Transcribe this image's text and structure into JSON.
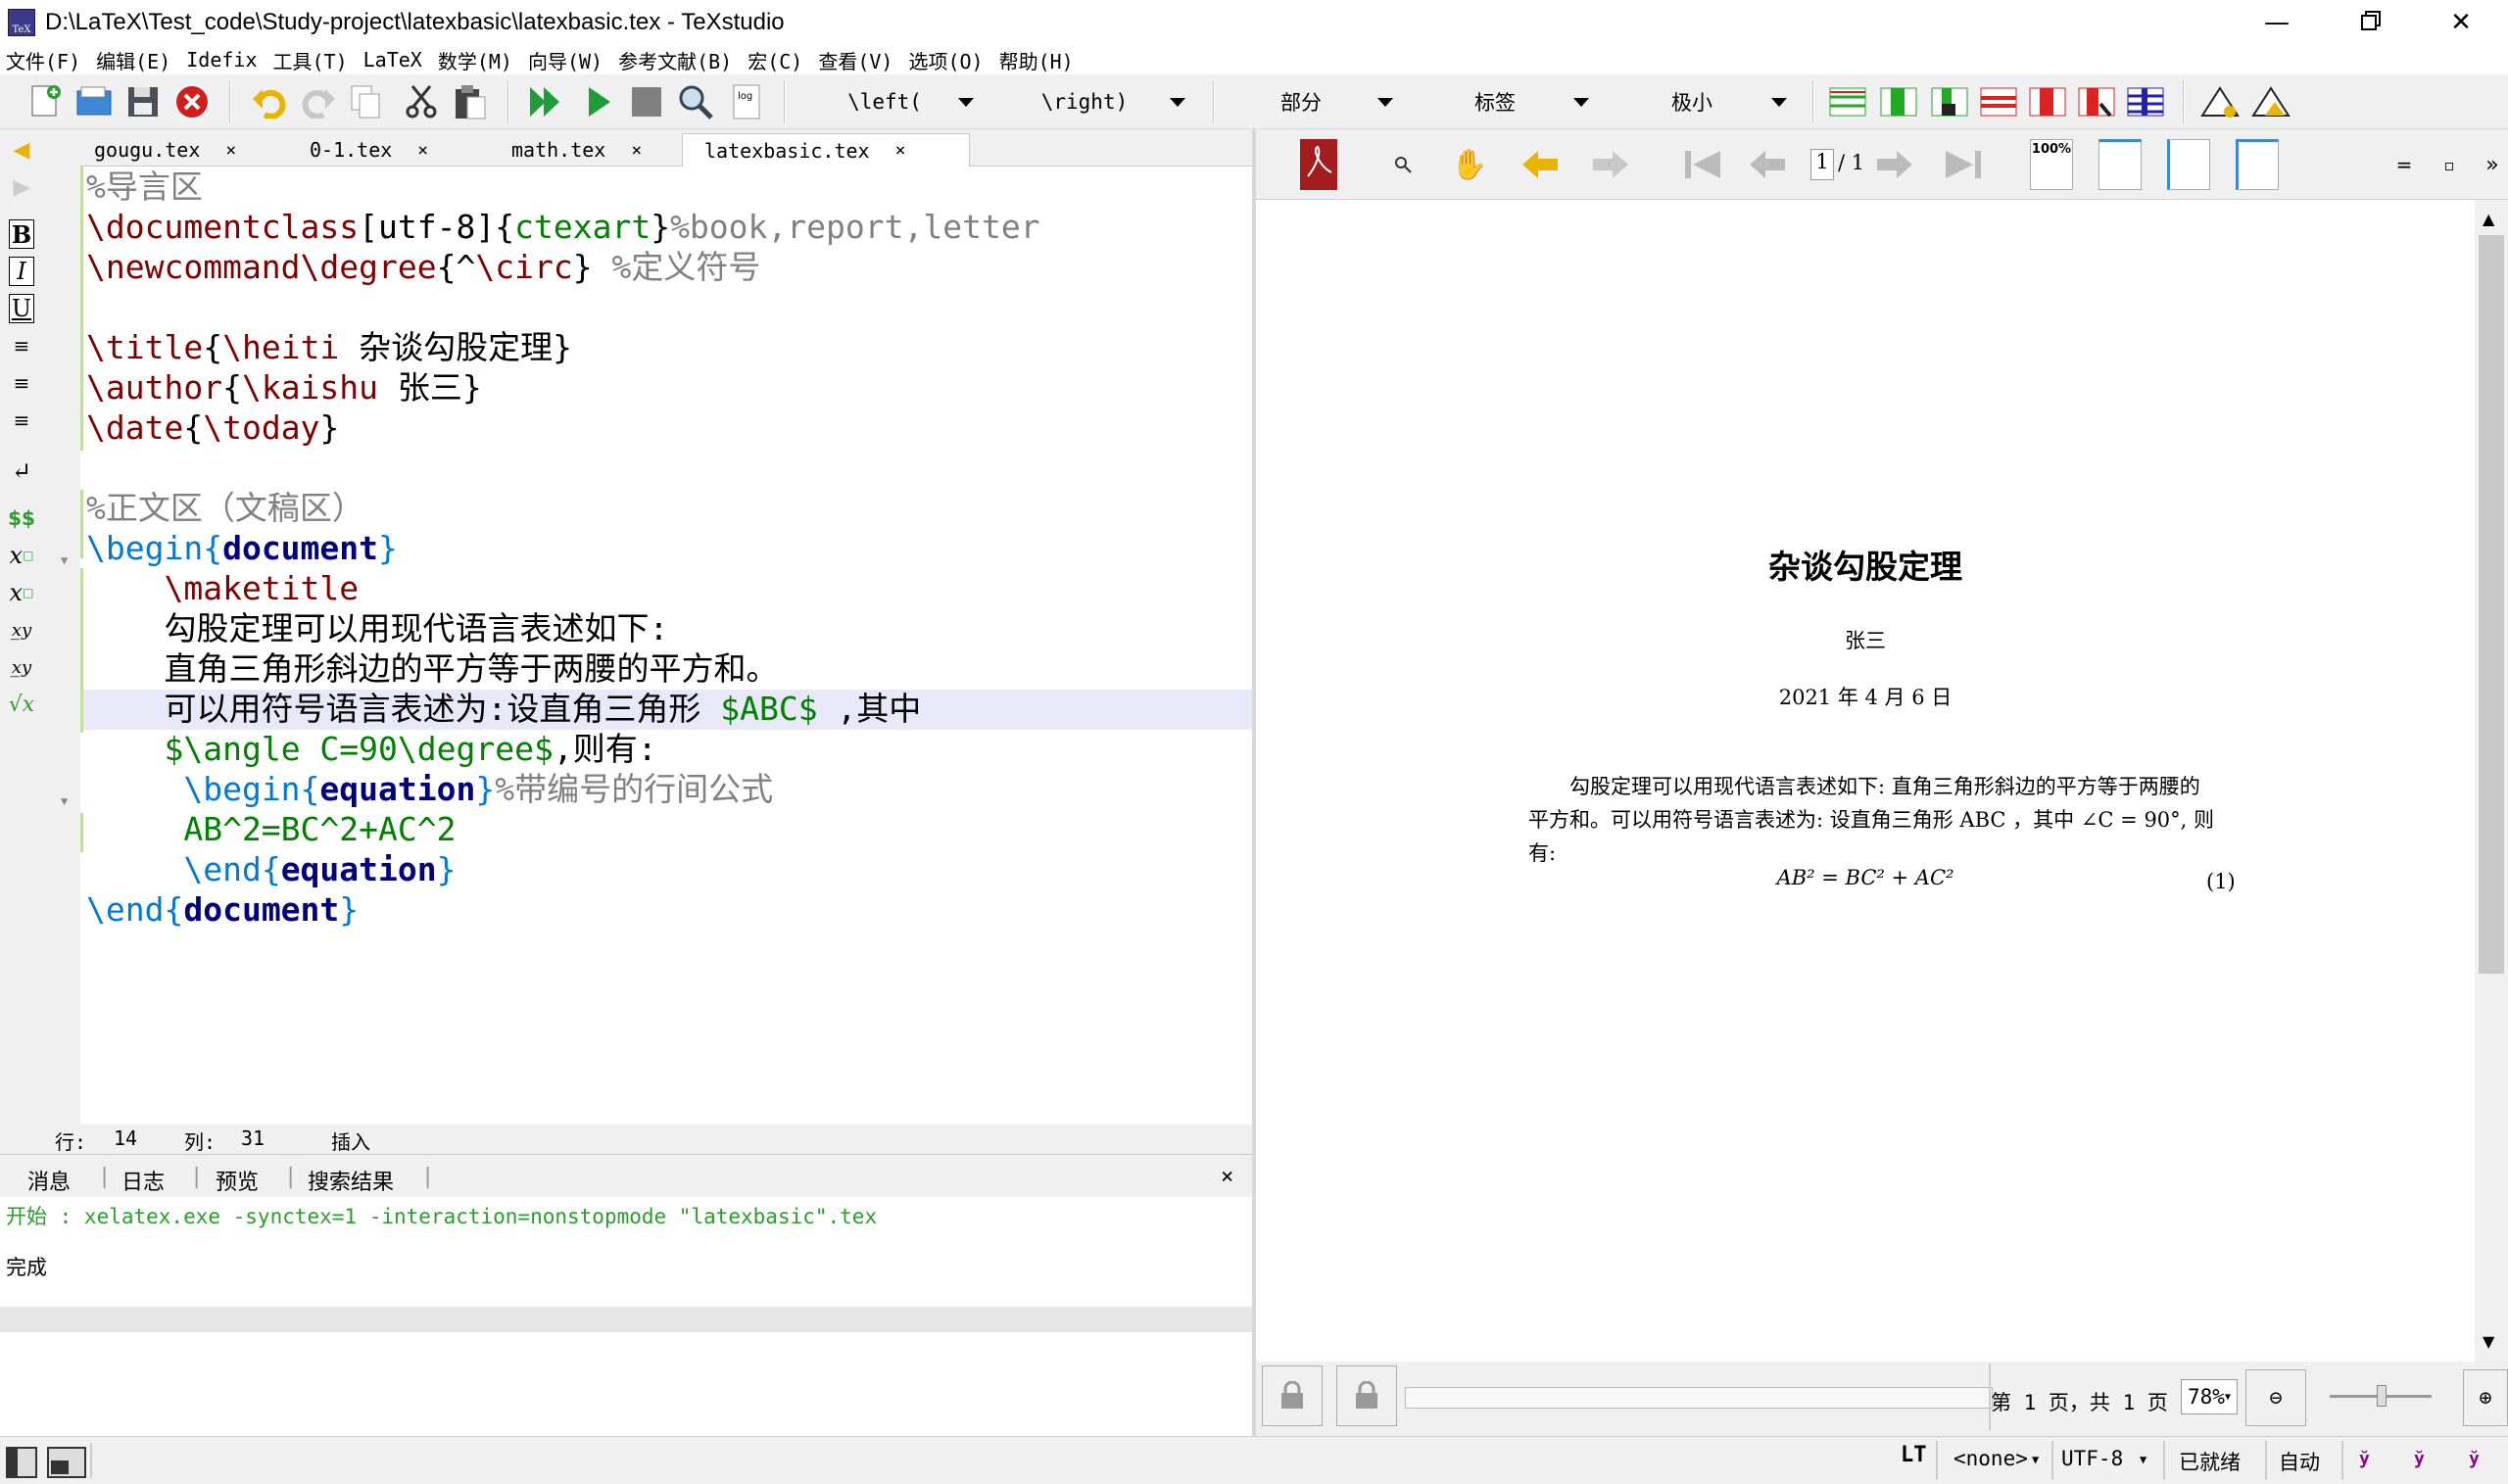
{
  "window": {
    "title": "D:\\LaTeX\\Test_code\\Study-project\\latexbasic\\latexbasic.tex - TeXstudio",
    "icon_label": "TeX"
  },
  "menu": [
    "文件(F)",
    "编辑(E)",
    "Idefix",
    "工具(T)",
    "LaTeX",
    "数学(M)",
    "向导(W)",
    "参考文献(B)",
    "宏(C)",
    "查看(V)",
    "选项(O)",
    "帮助(H)"
  ],
  "toolbar": {
    "left_combo": "\\left(",
    "right_combo": "\\right)",
    "section_combo": "部分",
    "label_combo": "标签",
    "size_combo": "极小"
  },
  "tabs": [
    {
      "label": "gougu.tex",
      "close": "×"
    },
    {
      "label": "0-1.tex",
      "close": "×"
    },
    {
      "label": "math.tex",
      "close": "×"
    },
    {
      "label": "latexbasic.tex",
      "close": "×"
    }
  ],
  "editor": {
    "lines": [
      "%导言区",
      "\\documentclass[utf-8]{ctexart}%book,report,letter",
      "\\newcommand\\degree{^\\circ} %定义符号",
      "",
      "\\title{\\heiti 杂谈勾股定理}",
      "\\author{\\kaishu 张三}",
      "\\date{\\today}",
      "",
      "%正文区（文稿区）",
      "\\begin{document}",
      "    \\maketitle",
      "    勾股定理可以用现代语言表述如下:",
      "    直角三角形斜边的平方等于两腰的平方和。",
      "    可以用符号语言表述为:设直角三角形 $ABC$ ,其中",
      "    $\\angle C=90\\degree$,则有:",
      "     \\begin{equation}%带编号的行间公式",
      "     AB^2=BC^2+AC^2",
      "     \\end{equation}",
      "\\end{document}"
    ],
    "status": {
      "row_label": "行:",
      "row": "14",
      "col_label": "列:",
      "col": "31",
      "mode": "插入"
    }
  },
  "messages": {
    "tabs": [
      "消息",
      "日志",
      "预览",
      "搜索结果"
    ],
    "close": "×",
    "lines": [
      "开始 : xelatex.exe -synctex=1 -interaction=nonstopmode \"latexbasic\".tex",
      "完成"
    ]
  },
  "pdf": {
    "page_input": "1",
    "page_total": "/ 1",
    "zoom_icon_label": "100%",
    "doc": {
      "title": "杂谈勾股定理",
      "author": "张三",
      "date": "2021 年 4 月 6 日",
      "para_line1": "勾股定理可以用现代语言表述如下: 直角三角形斜边的平方等于两腰的",
      "para_line2": "平方和。可以用符号语言表述为: 设直角三角形 ABC ，其中 ∠C = 90°, 则",
      "para_line3": "有:",
      "equation": "AB² = BC² + AC²",
      "eq_number": "(1)"
    },
    "footer": {
      "page_info": "第 1 页，共 1 页",
      "zoom": "78%"
    }
  },
  "statusbar": {
    "language": "<none>",
    "encoding": "UTF-8",
    "ready": "已就绪",
    "auto": "自动"
  },
  "colors": {
    "accent_green": "#008000",
    "cmd_red": "#800000",
    "env_blue": "#0078d7",
    "comment_gray": "#808080"
  }
}
